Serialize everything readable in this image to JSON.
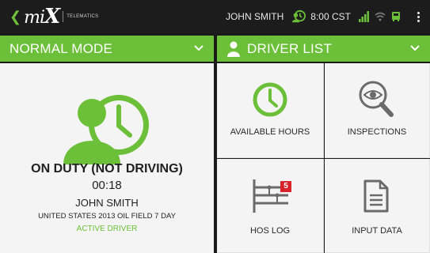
{
  "header": {
    "brand": "mix",
    "brand_sub": "TELEMATICS",
    "user": "JOHN SMITH",
    "time": "8:00 CST"
  },
  "mode": {
    "label": "NORMAL MODE"
  },
  "driver_list": {
    "label": "DRIVER LIST"
  },
  "duty": {
    "status": "ON DUTY (NOT DRIVING)",
    "time": "00:18",
    "driver_name": "JOHN SMITH",
    "ruleset": "UNITED STATES 2013 OIL FIELD 7 DAY",
    "active_label": "ACTIVE DRIVER"
  },
  "tiles": [
    {
      "label": "AVAILABLE HOURS",
      "icon": "clock-icon"
    },
    {
      "label": "INSPECTIONS",
      "icon": "eye-search-icon"
    },
    {
      "label": "HOS LOG",
      "icon": "hos-log-icon",
      "badge": "5"
    },
    {
      "label": "INPUT DATA",
      "icon": "document-icon"
    }
  ],
  "colors": {
    "accent": "#6cbf38",
    "badge": "#d8232a",
    "tile_bg": "#f4f4f4",
    "bar_bg": "#1c1c1c"
  }
}
